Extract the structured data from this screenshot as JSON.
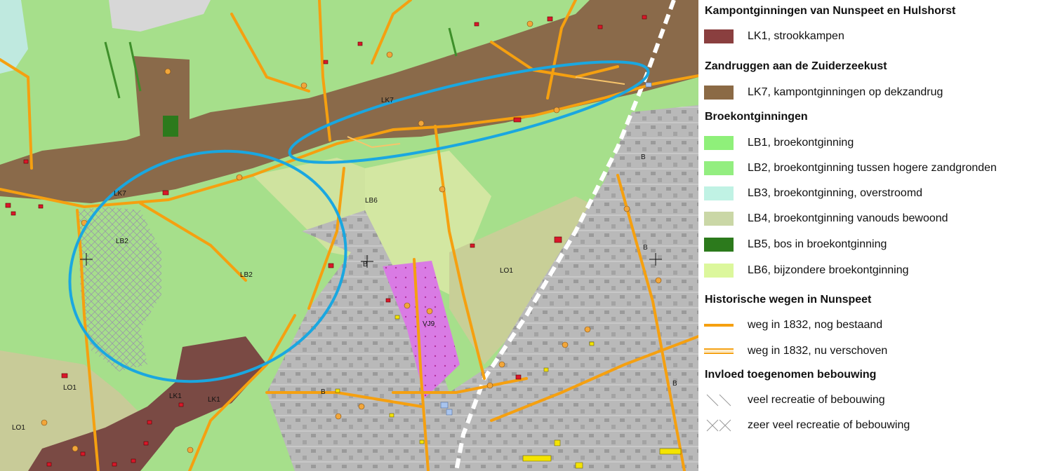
{
  "map": {
    "labels": [
      {
        "id": "lk7a",
        "text": "LK7"
      },
      {
        "id": "lk7b",
        "text": "LK7"
      },
      {
        "id": "lb6",
        "text": "LB6"
      },
      {
        "id": "lb2a",
        "text": "LB2"
      },
      {
        "id": "lb2b",
        "text": "LB2"
      },
      {
        "id": "b1",
        "text": "B"
      },
      {
        "id": "b2",
        "text": "B"
      },
      {
        "id": "b3",
        "text": "B"
      },
      {
        "id": "b4",
        "text": "B"
      },
      {
        "id": "b5",
        "text": "B"
      },
      {
        "id": "lo1a",
        "text": "LO1"
      },
      {
        "id": "lo1b",
        "text": "LO1"
      },
      {
        "id": "lo1c",
        "text": "LO1"
      },
      {
        "id": "vj9",
        "text": "VJ9"
      },
      {
        "id": "lk1a",
        "text": "LK1"
      },
      {
        "id": "lk1b",
        "text": "LK1"
      }
    ],
    "colors": {
      "lb2": "#a9e08d",
      "lk7": "#8a6a4a",
      "lk1": "#7a4a44",
      "lb6": "#cfe5a2",
      "lb4": "#cccc9c",
      "lb3": "#bfe9df",
      "built": "#b8b8b8",
      "vj9": "#d97be4",
      "road": "#f5a010",
      "ellipse": "#1aa7e0"
    }
  },
  "legend": {
    "sections": [
      {
        "heading": "Kampontginningen van Nunspeet en Hulshorst",
        "items": [
          {
            "key": "lk1",
            "label": "LK1, strookkampen",
            "color": "#8a3f3f",
            "kind": "fill"
          }
        ]
      },
      {
        "heading": "Zandruggen aan de Zuiderzeekust",
        "items": [
          {
            "key": "lk7",
            "label": "LK7, kampontginningen op dekzandrug",
            "color": "#8b6a45",
            "kind": "fill"
          }
        ]
      },
      {
        "heading": "Broekontginningen",
        "items": [
          {
            "key": "lb1",
            "label": "LB1, broekontginning",
            "color": "#8ff07a",
            "kind": "fill"
          },
          {
            "key": "lb2",
            "label": "LB2, broekontginning tussen hogere zandgronden",
            "color": "#93ee80",
            "kind": "fill"
          },
          {
            "key": "lb3",
            "label": "LB3, broekontginning, overstroomd",
            "color": "#c0f2e4",
            "kind": "fill"
          },
          {
            "key": "lb4",
            "label": "LB4, broekontginning vanouds bewoond",
            "color": "#cad7a6",
            "kind": "fill"
          },
          {
            "key": "lb5",
            "label": "LB5, bos in broekontginning",
            "color": "#2c7a1c",
            "kind": "fill"
          },
          {
            "key": "lb6",
            "label": "LB6, bijzondere broekontginning",
            "color": "#dcf79c",
            "kind": "fill"
          }
        ]
      },
      {
        "heading": "Historische wegen in Nunspeet",
        "items": [
          {
            "key": "road1832",
            "label": "weg in 1832, nog bestaand",
            "color": "#f5a010",
            "kind": "line"
          },
          {
            "key": "road1832moved",
            "label": "weg in 1832, nu verschoven",
            "color": "#f5a010",
            "kind": "doubleline"
          }
        ]
      },
      {
        "heading": "Invloed toegenomen bebouwing",
        "items": [
          {
            "key": "recreatie",
            "label": "veel recreatie of bebouwing",
            "color": "#aaaaaa",
            "kind": "hatch"
          },
          {
            "key": "zeerveel",
            "label": "zeer veel recreatie of bebouwing",
            "color": "#aaaaaa",
            "kind": "crosshatch"
          }
        ]
      }
    ]
  }
}
